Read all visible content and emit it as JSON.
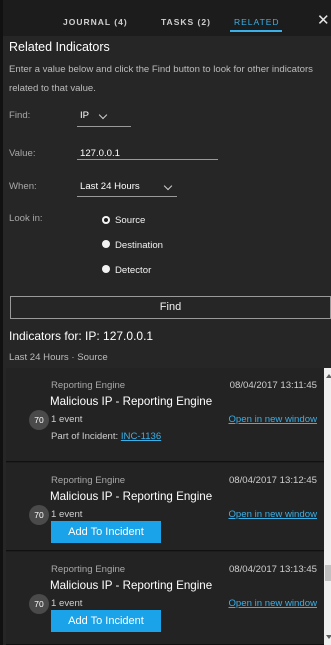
{
  "tabs": [
    {
      "label": "JOURNAL (4)"
    },
    {
      "label": "TASKS (2)"
    },
    {
      "label": "RELATED"
    }
  ],
  "panel": {
    "title": "Related Indicators",
    "description": "Enter a value below and click the Find button to look for other indicators related to that value.",
    "find_label": "Find:",
    "find_value": "IP",
    "value_label": "Value:",
    "value_value": "127.0.0.1",
    "when_label": "When:",
    "when_value": "Last 24 Hours",
    "lookin_label": "Look in:",
    "lookin_options": [
      {
        "label": "Source",
        "selected": true
      },
      {
        "label": "Destination",
        "selected": false
      },
      {
        "label": "Detector",
        "selected": false
      }
    ],
    "find_button": "Find"
  },
  "results": {
    "title": "Indicators for: IP: 127.0.0.1",
    "subtitle": "Last 24 Hours · Source",
    "items": [
      {
        "source": "Reporting Engine",
        "timestamp": "08/04/2017 13:11:45",
        "title": "Malicious IP - Reporting Engine",
        "score": "70",
        "count": "1 event",
        "open_link": "Open in new window",
        "part_label": "Part of Incident:",
        "incident": "INC-1136"
      },
      {
        "source": "Reporting Engine",
        "timestamp": "08/04/2017 13:12:45",
        "title": "Malicious IP - Reporting Engine",
        "score": "70",
        "count": "1 event",
        "open_link": "Open in new window",
        "add_button": "Add To Incident"
      },
      {
        "source": "Reporting Engine",
        "timestamp": "08/04/2017 13:13:45",
        "title": "Malicious IP - Reporting Engine",
        "score": "70",
        "count": "1 event",
        "open_link": "Open in new window",
        "add_button": "Add To Incident"
      }
    ]
  },
  "icons": {
    "close": "close-icon",
    "chevron": "chevron-down-icon",
    "scroll_up": "arrow-up-icon",
    "scroll_down": "arrow-down-icon"
  },
  "colors": {
    "accent": "#3ab0e8",
    "button": "#1aa3e8",
    "background": "#262626"
  }
}
